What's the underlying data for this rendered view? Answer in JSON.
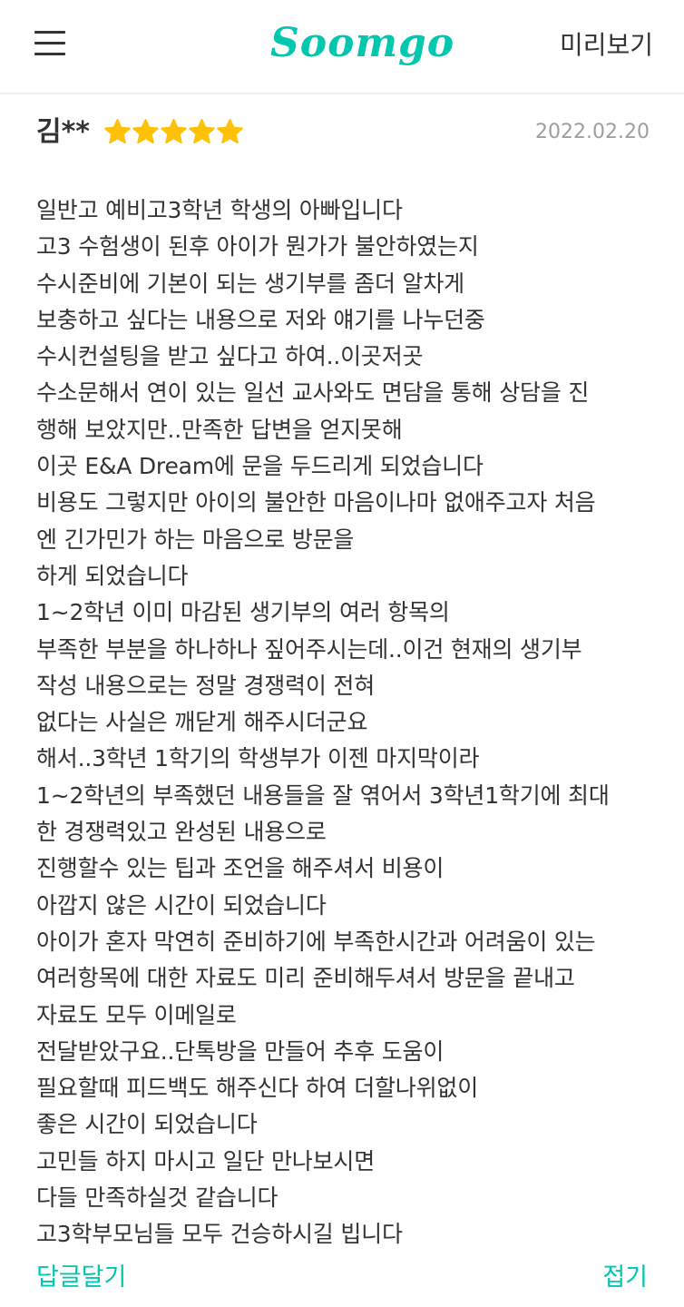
{
  "header": {
    "logo_text": "Soomgo",
    "preview_label": "미리보기",
    "menu_icon": "hamburger-menu-icon"
  },
  "review": {
    "reviewer_name": "김**",
    "rating": 5,
    "rating_max": 5,
    "star_color": "#FFC107",
    "date": "2022.02.20",
    "lines": [
      "일반고 예비고3학년 학생의 아빠입니다",
      "고3 수험생이 된후 아이가 뭔가가 불안하였는지",
      "수시준비에 기본이 되는 생기부를 좀더 알차게",
      "보충하고 싶다는 내용으로 저와 얘기를 나누던중",
      "수시컨설팅을 받고 싶다고 하여..이곳저곳",
      "수소문해서 연이 있는 일선 교사와도 면담을 통해 상담을 진",
      "행해 보았지만..만족한 답변을 얻지못해",
      "이곳 E&A Dream에 문을 두드리게 되었습니다",
      "비용도 그렇지만 아이의 불안한 마음이나마 없애주고자 처음",
      "엔 긴가민가 하는 마음으로 방문을",
      "하게 되었습니다",
      "1~2학년 이미 마감된 생기부의 여러 항목의",
      "부족한 부분을 하나하나 짚어주시는데..이건 현재의 생기부",
      "작성 내용으로는 정말 경쟁력이 전혀",
      "없다는 사실은 깨닫게 해주시더군요",
      "해서..3학년 1학기의 학생부가 이젠 마지막이라",
      "1~2학년의 부족했던 내용들을 잘 엮어서 3학년1학기에 최대",
      "한 경쟁력있고 완성된 내용으로",
      "진행할수 있는 팁과 조언을 해주셔서 비용이",
      "아깝지 않은 시간이 되었습니다",
      "아이가 혼자 막연히 준비하기에 부족한시간과 어려움이 있는",
      "여러항목에 대한 자료도 미리 준비해두셔서 방문을 끝내고",
      "자료도 모두 이메일로",
      "전달받았구요..단톡방을 만들어 추후 도움이",
      "필요할때 피드백도 해주신다 하여 더할나위없이",
      "좋은 시간이 되었습니다",
      "고민들 하지 마시고 일단 만나보시면",
      "다들 만족하실것 같습니다",
      "고3학부모님들 모두 건승하시길 빕니다"
    ]
  },
  "actions": {
    "reply_label": "답글달기",
    "collapse_label": "접기"
  },
  "colors": {
    "brand": "#00C7AE",
    "text": "#333333",
    "date": "#9E9E9E"
  }
}
